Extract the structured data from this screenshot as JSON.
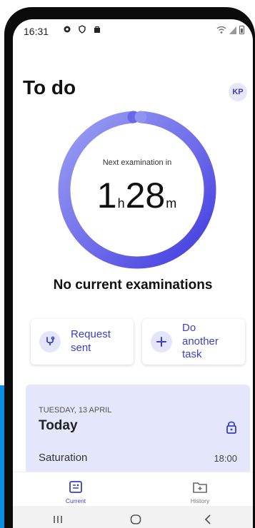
{
  "status_bar": {
    "time": "16:31",
    "left_icons": [
      "settings-icon",
      "shield-icon",
      "bag-icon"
    ],
    "right_icons": [
      "wifi-icon",
      "signal-icon",
      "battery-icon"
    ]
  },
  "header": {
    "title": "To do",
    "avatar_initials": "KP"
  },
  "timer": {
    "label": "Next examination in",
    "hours": "1",
    "hours_unit": "h",
    "minutes": "28",
    "minutes_unit": "m"
  },
  "no_current": "No current examinations",
  "actions": {
    "request": {
      "label": "Request sent",
      "icon": "stethoscope-icon"
    },
    "another": {
      "label": "Do another task",
      "icon": "plus-icon"
    }
  },
  "today": {
    "date": "TUESDAY, 13 APRIL",
    "title": "Today",
    "exam_name": "Saturation",
    "exam_time": "18:00"
  },
  "bottom_nav": {
    "current": "Current",
    "history": "History"
  },
  "colors": {
    "accent": "#3b3ec9",
    "ring_start": "#8a8ff0",
    "ring_end": "#4a46e0",
    "panel": "#e4e7fb",
    "frame": "#0b0b0b",
    "backdrop": "#0a8fe3"
  }
}
